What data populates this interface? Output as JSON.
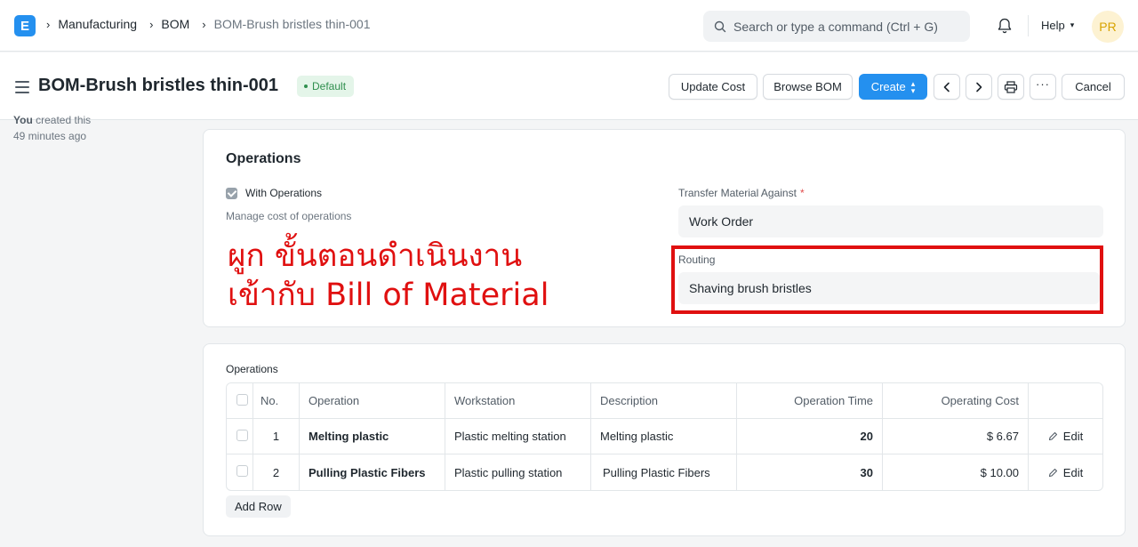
{
  "navbar": {
    "logo_letter": "E",
    "breadcrumbs": [
      "Manufacturing",
      "BOM",
      "BOM-Brush bristles thin-001"
    ],
    "search_placeholder": "Search or type a command (Ctrl + G)",
    "help_label": "Help",
    "avatar_initials": "PR"
  },
  "header": {
    "title": "BOM-Brush bristles thin-001",
    "status_badge": "Default",
    "buttons": {
      "update_cost": "Update Cost",
      "browse_bom": "Browse BOM",
      "create": "Create",
      "cancel": "Cancel"
    }
  },
  "sidebar": {
    "created_by": "You",
    "created_text": "created this",
    "created_time": "49 minutes ago"
  },
  "operations_section": {
    "title": "Operations",
    "with_operations_label": "With Operations",
    "with_operations_checked": true,
    "with_operations_description": "Manage cost of operations",
    "transfer_label": "Transfer Material Against",
    "transfer_required_mark": "*",
    "transfer_value": "Work Order",
    "routing_label": "Routing",
    "routing_value": "Shaving brush bristles",
    "annotation_line1": "ผูก ขั้นตอนดำเนินงาน",
    "annotation_line2": "เข้ากับ Bill of Material",
    "annotation_color": "#e01010"
  },
  "operations_table": {
    "label": "Operations",
    "columns": [
      "No.",
      "Operation",
      "Workstation",
      "Description",
      "Operation Time",
      "Operating Cost"
    ],
    "rows": [
      {
        "no": "1",
        "operation": "Melting plastic",
        "workstation": "Plastic melting station",
        "description": "Melting plastic",
        "time": "20",
        "cost": "$ 6.67",
        "edit": "Edit"
      },
      {
        "no": "2",
        "operation": "Pulling Plastic Fibers",
        "workstation": "Plastic pulling station",
        "description": "Pulling Plastic Fibers",
        "time": "30",
        "cost": "$ 10.00",
        "edit": "Edit"
      }
    ],
    "add_row_label": "Add Row"
  },
  "colors": {
    "primary": "#2490ef",
    "badge_green": "#2f8f4e",
    "annotation_red": "#e01010"
  }
}
